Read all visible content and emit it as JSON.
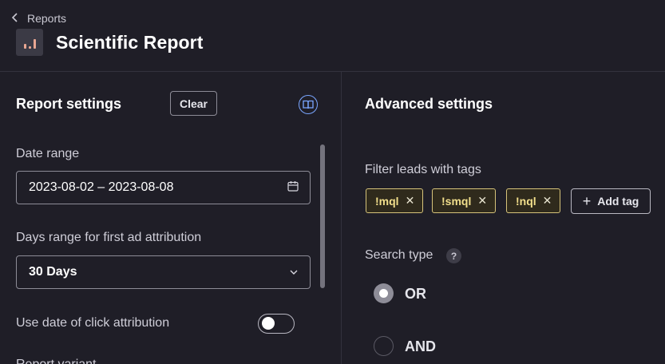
{
  "header": {
    "back_label": "Reports",
    "title": "Scientific Report",
    "icons": {
      "back": "chevron-left-icon",
      "logo": "bar-chart-icon"
    }
  },
  "report_settings": {
    "title": "Report settings",
    "clear_label": "Clear",
    "help_icon": "book-icon",
    "date_range": {
      "label": "Date range",
      "value": "2023-08-02 – 2023-08-08",
      "icon": "calendar-icon"
    },
    "days_range": {
      "label": "Days range for first ad attribution",
      "value": "30 Days",
      "icon": "chevron-down-icon"
    },
    "click_attribution": {
      "label": "Use date of click attribution",
      "enabled": false
    },
    "next_label_partial": "Report variant"
  },
  "advanced_settings": {
    "title": "Advanced settings",
    "filter_label": "Filter leads with tags",
    "tags": [
      {
        "label": "!mql"
      },
      {
        "label": "!smql"
      },
      {
        "label": "!nql"
      }
    ],
    "add_tag_label": "Add tag",
    "search_type": {
      "label": "Search type",
      "help": "?",
      "options": [
        {
          "label": "OR",
          "selected": true
        },
        {
          "label": "AND",
          "selected": false
        }
      ]
    }
  },
  "colors": {
    "background": "#1f1e27",
    "tag_border": "#d6c37a",
    "tag_text": "#f2df8c",
    "accent_icon": "#7aa6ff"
  }
}
